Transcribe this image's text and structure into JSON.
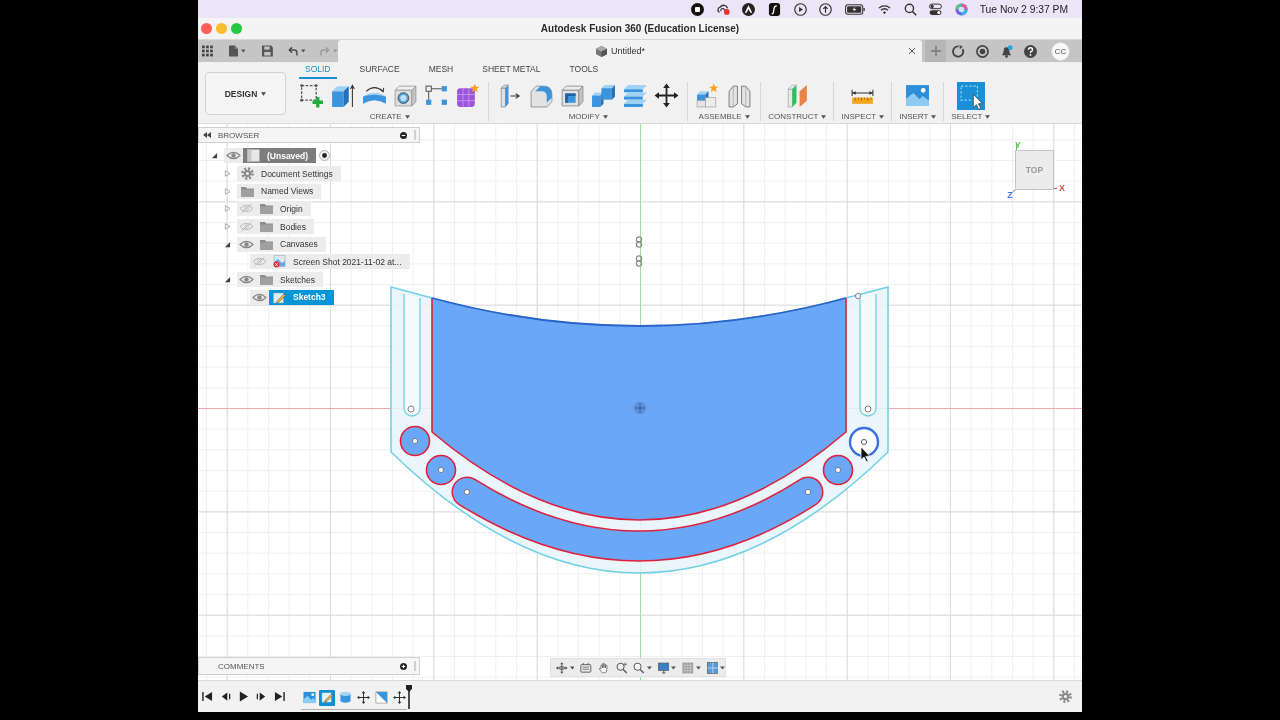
{
  "menu_bar": {
    "clock": "Tue Nov 2 9:37 PM"
  },
  "window": {
    "title": "Autodesk Fusion 360 (Education License)"
  },
  "quick_access": {
    "history": [
      {
        "kind": "undo",
        "disabled": false
      },
      {
        "kind": "redo",
        "disabled": true
      }
    ]
  },
  "document_tab": {
    "title": "Untitled*"
  },
  "notifications": {
    "unread": true
  },
  "account": {
    "initials": "CC"
  },
  "workspace": {
    "label": "DESIGN"
  },
  "toolbar_tabs": [
    {
      "label": "SOLID",
      "selected": true
    },
    {
      "label": "SURFACE",
      "selected": false
    },
    {
      "label": "MESH",
      "selected": false
    },
    {
      "label": "SHEET METAL",
      "selected": false
    },
    {
      "label": "TOOLS",
      "selected": false
    }
  ],
  "tool_groups": [
    {
      "label": "CREATE"
    },
    {
      "label": "MODIFY"
    },
    {
      "label": "ASSEMBLE"
    },
    {
      "label": "CONSTRUCT"
    },
    {
      "label": "INSPECT"
    },
    {
      "label": "INSERT"
    },
    {
      "label": "SELECT"
    }
  ],
  "browser": {
    "title": "BROWSER",
    "tree": [
      {
        "label": "(Unsaved)",
        "kind": "component",
        "expanded": true,
        "visible": true,
        "active": true,
        "selected": false,
        "children": [
          {
            "label": "Document Settings",
            "kind": "settings",
            "expanded": false,
            "selected": false
          },
          {
            "label": "Named Views",
            "kind": "folder",
            "expanded": false,
            "selected": false
          },
          {
            "label": "Origin",
            "kind": "folder",
            "expanded": false,
            "visible": false,
            "selected": false
          },
          {
            "label": "Bodies",
            "kind": "folder",
            "expanded": false,
            "visible": false,
            "selected": false
          },
          {
            "label": "Canvases",
            "kind": "folder",
            "expanded": true,
            "visible": true,
            "selected": false,
            "children": [
              {
                "label": "Screen Shot 2021-11-02 at...",
                "kind": "canvas",
                "visible": false,
                "selected": false
              }
            ]
          },
          {
            "label": "Sketches",
            "kind": "folder",
            "expanded": true,
            "visible": true,
            "selected": false,
            "children": [
              {
                "label": "Sketch3",
                "kind": "sketch",
                "visible": true,
                "selected": true
              }
            ]
          }
        ]
      }
    ]
  },
  "view_cube": {
    "face": "TOP",
    "axes": [
      {
        "label": "Y",
        "color": "#5cc45c"
      },
      {
        "label": "X",
        "color": "#e04848"
      },
      {
        "label": "Z",
        "color": "#4a78e0"
      }
    ]
  },
  "comments": {
    "title": "COMMENTS"
  },
  "timeline": {
    "features": [
      {
        "kind": "canvas",
        "selected": false
      },
      {
        "kind": "sketch",
        "selected": true
      },
      {
        "kind": "extrude",
        "selected": false
      },
      {
        "kind": "move",
        "selected": false
      },
      {
        "kind": "body",
        "selected": false
      },
      {
        "kind": "move",
        "selected": false
      }
    ]
  }
}
